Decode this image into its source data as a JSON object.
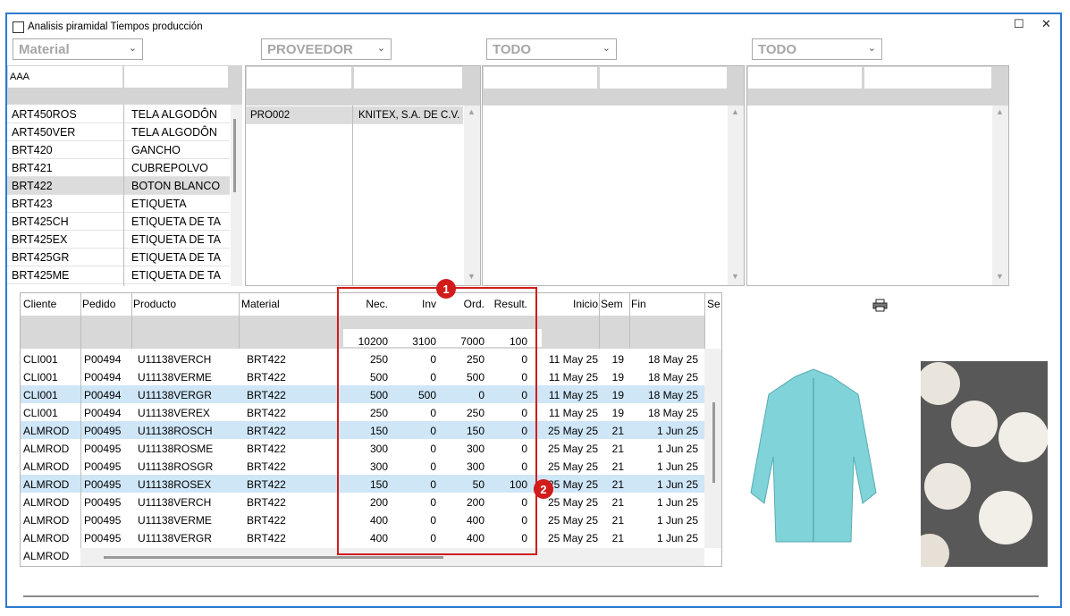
{
  "window": {
    "title": "Analisis piramidal  Tiempos producción",
    "maximize": "☐",
    "close": "✕"
  },
  "filters": [
    "Material",
    "PROVEEDOR",
    "TODO",
    "TODO"
  ],
  "material_panel": {
    "search": "AAA",
    "items": [
      {
        "code": "ART450ROS",
        "desc": "TELA ALGODÔN"
      },
      {
        "code": "ART450VER",
        "desc": "TELA ALGODÔN"
      },
      {
        "code": "BRT420",
        "desc": "GANCHO"
      },
      {
        "code": "BRT421",
        "desc": "CUBREPOLVO"
      },
      {
        "code": "BRT422",
        "desc": "BOTON BLANCO"
      },
      {
        "code": "BRT423",
        "desc": "ETIQUETA"
      },
      {
        "code": "BRT425CH",
        "desc": "ETIQUETA DE TA"
      },
      {
        "code": "BRT425EX",
        "desc": "ETIQUETA DE TA"
      },
      {
        "code": "BRT425GR",
        "desc": "ETIQUETA DE TA"
      },
      {
        "code": "BRT425ME",
        "desc": "ETIQUETA DE TA"
      }
    ],
    "selected_index": 4
  },
  "provider_panel": {
    "items": [
      {
        "code": "PRO002",
        "name": "KNITEX, S.A. DE C.V."
      }
    ]
  },
  "grid": {
    "headers": [
      "Cliente",
      "Pedido",
      "Producto",
      "Material",
      "Nec.",
      "Inv",
      "Ord.",
      "Result.",
      "Inicio",
      "Sem",
      "Fin",
      "Se"
    ],
    "totals": {
      "nec": "10200",
      "inv": "3100",
      "ord": "7000",
      "result": "100"
    },
    "rows": [
      {
        "cliente": "CLI001",
        "pedido": "P00494",
        "producto": "U11138VERCH",
        "material": "BRT422",
        "nec": "250",
        "inv": "0",
        "ord": "250",
        "result": "0",
        "inicio": "11 May 25",
        "sem": "19",
        "fin": "18 May 25",
        "hl": false
      },
      {
        "cliente": "CLI001",
        "pedido": "P00494",
        "producto": "U11138VERME",
        "material": "BRT422",
        "nec": "500",
        "inv": "0",
        "ord": "500",
        "result": "0",
        "inicio": "11 May 25",
        "sem": "19",
        "fin": "18 May 25",
        "hl": false
      },
      {
        "cliente": "CLI001",
        "pedido": "P00494",
        "producto": "U11138VERGR",
        "material": "BRT422",
        "nec": "500",
        "inv": "500",
        "ord": "0",
        "result": "0",
        "inicio": "11 May 25",
        "sem": "19",
        "fin": "18 May 25",
        "hl": true
      },
      {
        "cliente": "CLI001",
        "pedido": "P00494",
        "producto": "U11138VEREX",
        "material": "BRT422",
        "nec": "250",
        "inv": "0",
        "ord": "250",
        "result": "0",
        "inicio": "11 May 25",
        "sem": "19",
        "fin": "18 May 25",
        "hl": false
      },
      {
        "cliente": "ALMROD",
        "pedido": "P00495",
        "producto": "U11138ROSCH",
        "material": "BRT422",
        "nec": "150",
        "inv": "0",
        "ord": "150",
        "result": "0",
        "inicio": "25 May 25",
        "sem": "21",
        "fin": "1 Jun 25",
        "hl": true
      },
      {
        "cliente": "ALMROD",
        "pedido": "P00495",
        "producto": "U11138ROSME",
        "material": "BRT422",
        "nec": "300",
        "inv": "0",
        "ord": "300",
        "result": "0",
        "inicio": "25 May 25",
        "sem": "21",
        "fin": "1 Jun 25",
        "hl": false
      },
      {
        "cliente": "ALMROD",
        "pedido": "P00495",
        "producto": "U11138ROSGR",
        "material": "BRT422",
        "nec": "300",
        "inv": "0",
        "ord": "300",
        "result": "0",
        "inicio": "25 May 25",
        "sem": "21",
        "fin": "1 Jun 25",
        "hl": false
      },
      {
        "cliente": "ALMROD",
        "pedido": "P00495",
        "producto": "U11138ROSEX",
        "material": "BRT422",
        "nec": "150",
        "inv": "0",
        "ord": "50",
        "result": "100",
        "inicio": "25 May 25",
        "sem": "21",
        "fin": "1 Jun 25",
        "hl": true
      },
      {
        "cliente": "ALMROD",
        "pedido": "P00495",
        "producto": "U11138VERCH",
        "material": "BRT422",
        "nec": "200",
        "inv": "0",
        "ord": "200",
        "result": "0",
        "inicio": "25 May 25",
        "sem": "21",
        "fin": "1 Jun 25",
        "hl": false
      },
      {
        "cliente": "ALMROD",
        "pedido": "P00495",
        "producto": "U11138VERME",
        "material": "BRT422",
        "nec": "400",
        "inv": "0",
        "ord": "400",
        "result": "0",
        "inicio": "25 May 25",
        "sem": "21",
        "fin": "1 Jun 25",
        "hl": false
      },
      {
        "cliente": "ALMROD",
        "pedido": "P00495",
        "producto": "U11138VERGR",
        "material": "BRT422",
        "nec": "400",
        "inv": "0",
        "ord": "400",
        "result": "0",
        "inicio": "25 May 25",
        "sem": "21",
        "fin": "1 Jun 25",
        "hl": false
      }
    ],
    "partial_row": "ALMROD"
  },
  "badges": [
    "1",
    "2"
  ],
  "icons": {
    "print": "printer-icon",
    "maximize": "maximize-icon",
    "close": "close-icon",
    "dropdown": "chevron-down-icon"
  },
  "colors": {
    "accent": "#2d7bd0",
    "highlight_row": "#cfe6f7",
    "badge": "#d21b1b",
    "header_gray": "#d4d4d4"
  }
}
